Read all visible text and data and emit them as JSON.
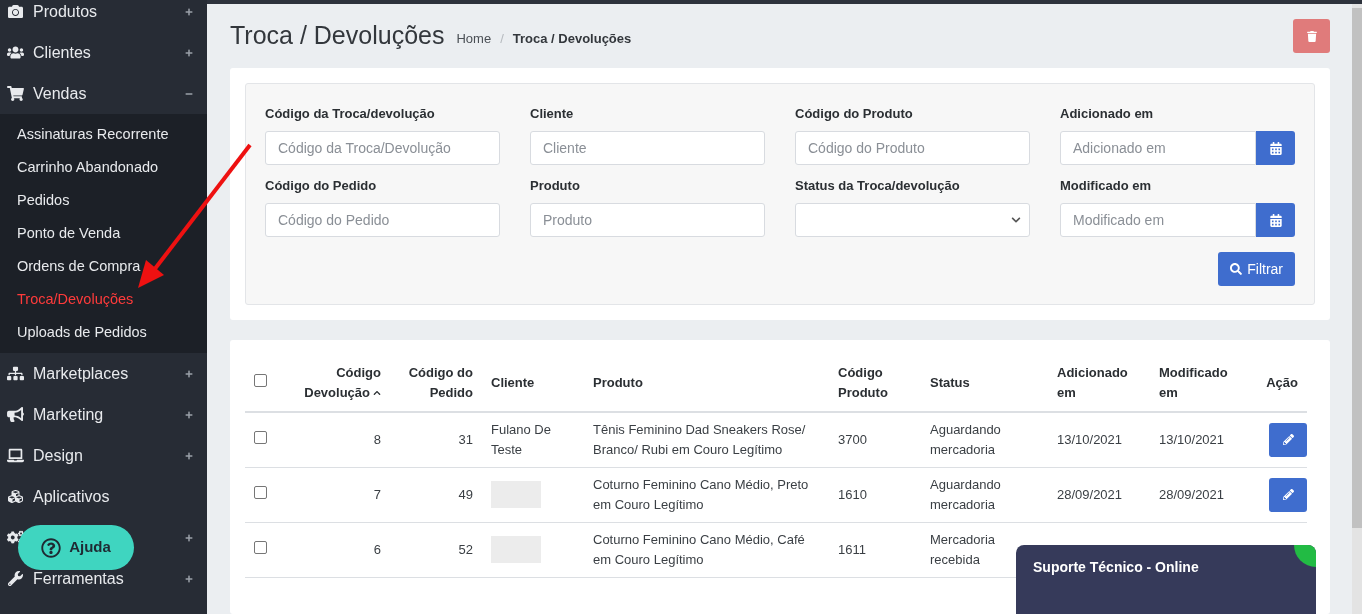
{
  "sidebar": {
    "items": [
      {
        "label": "Produtos",
        "expanded": false
      },
      {
        "label": "Clientes",
        "expanded": false
      },
      {
        "label": "Vendas",
        "expanded": true,
        "children": [
          {
            "label": "Assinaturas Recorrente",
            "selected": false
          },
          {
            "label": "Carrinho Abandonado",
            "selected": false
          },
          {
            "label": "Pedidos",
            "selected": false
          },
          {
            "label": "Ponto de Venda",
            "selected": false
          },
          {
            "label": "Ordens de Compra",
            "selected": false
          },
          {
            "label": "Troca/Devoluções",
            "selected": true
          },
          {
            "label": "Uploads de Pedidos",
            "selected": false
          }
        ]
      },
      {
        "label": "Marketplaces",
        "expanded": false
      },
      {
        "label": "Marketing",
        "expanded": false
      },
      {
        "label": "Design",
        "expanded": false
      },
      {
        "label": "Aplicativos"
      },
      {
        "expanded": false
      },
      {
        "label": "Ferramentas",
        "expanded": false
      }
    ]
  },
  "help_button": {
    "label": "Ajuda"
  },
  "header": {
    "title": "Troca / Devoluções",
    "breadcrumb": [
      {
        "label": "Home"
      },
      {
        "label": "Troca / Devoluções"
      }
    ],
    "breadcrumb_separator": "/"
  },
  "filters": [
    {
      "kind": "text",
      "label": "Código da Troca/devolução",
      "placeholder": "Código da Troca/Devolução"
    },
    {
      "kind": "text",
      "label": "Cliente",
      "placeholder": "Cliente"
    },
    {
      "kind": "text",
      "label": "Código do Produto",
      "placeholder": "Código do Produto"
    },
    {
      "kind": "date",
      "label": "Adicionado em",
      "placeholder": "Adicionado em"
    },
    {
      "kind": "text",
      "label": "Código do Pedido",
      "placeholder": "Código do Pedido"
    },
    {
      "kind": "text",
      "label": "Produto",
      "placeholder": "Produto"
    },
    {
      "kind": "select",
      "label": "Status da Troca/devolução"
    },
    {
      "kind": "date",
      "label": "Modificado em",
      "placeholder": "Modificado em"
    }
  ],
  "filter_button": "Filtrar",
  "table": {
    "select_all": {
      "checked": false
    },
    "columns": [
      {
        "label": "Código Devolução",
        "sorted": true
      },
      {
        "label": "Código do Pedido",
        "sorted": false
      },
      {
        "label": "Cliente",
        "sorted": false
      },
      {
        "label": "Produto",
        "sorted": false
      },
      {
        "label": "Código Produto",
        "sorted": false
      },
      {
        "label": "Status",
        "sorted": false
      },
      {
        "label": "Adicionado em",
        "sorted": false
      },
      {
        "label": "Modificado em",
        "sorted": false
      },
      {
        "label": "Ação",
        "sorted": false
      }
    ],
    "rows": [
      {
        "checked": false,
        "code": "8",
        "order": "31",
        "client": "Fulano De Teste",
        "redacted": false,
        "product": "Tênis Feminino Dad Sneakers Rose/ Branco/ Rubi em Couro Legítimo",
        "product_code": "3700",
        "status": "Aguardando mercadoria",
        "added": "13/10/2021",
        "modified": "13/10/2021"
      },
      {
        "checked": false,
        "code": "7",
        "order": "49",
        "redacted": true,
        "product": "Coturno Feminino Cano Médio, Preto em Couro Legítimo",
        "product_code": "1610",
        "status": "Aguardando mercadoria",
        "added": "28/09/2021",
        "modified": "28/09/2021"
      },
      {
        "checked": false,
        "code": "6",
        "order": "52",
        "redacted": true,
        "product": "Coturno Feminino Cano Médio, Café em Couro Legítimo",
        "product_code": "1611",
        "status": "Mercadoria recebida"
      }
    ]
  },
  "support_widget": {
    "title": "Suporte Técnico - Online",
    "online": true
  }
}
